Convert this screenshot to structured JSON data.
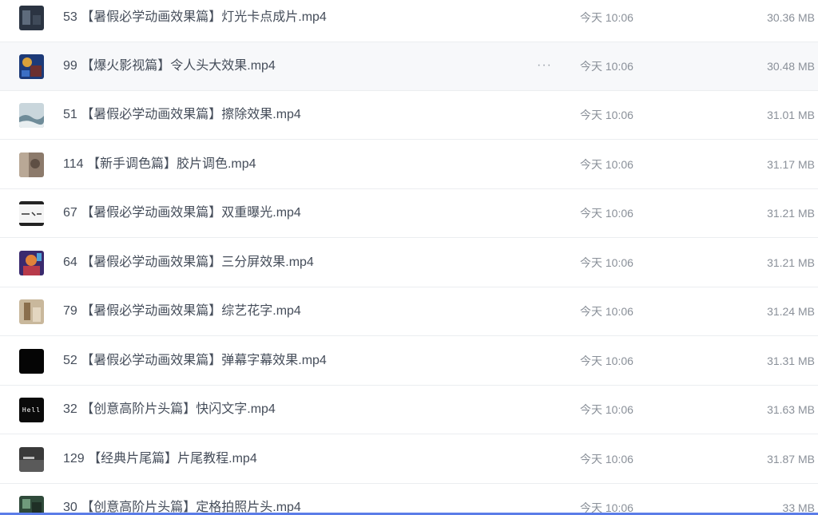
{
  "file_list": {
    "hover_more_icon": "more-horizontal-icon",
    "more_glyph": "···",
    "rows": [
      {
        "name": "53 【暑假必学动画效果篇】灯光卡点成片.mp4",
        "time": "今天 10:06",
        "size": "30.36 MB",
        "thumb": "dark-scene-thumbnail"
      },
      {
        "name": "99 【爆火影视篇】令人头大效果.mp4",
        "time": "今天 10:06",
        "size": "30.48 MB",
        "thumb": "movie-scene-thumbnail"
      },
      {
        "name": "51 【暑假必学动画效果篇】擦除效果.mp4",
        "time": "今天 10:06",
        "size": "31.01 MB",
        "thumb": "sea-scene-thumbnail"
      },
      {
        "name": "114 【新手调色篇】胶片调色.mp4",
        "time": "今天 10:06",
        "size": "31.17 MB",
        "thumb": "film-scene-thumbnail"
      },
      {
        "name": "67 【暑假必学动画效果篇】双重曝光.mp4",
        "time": "今天 10:06",
        "size": "31.21 MB",
        "thumb": "sketch-thumbnail"
      },
      {
        "name": "64 【暑假必学动画效果篇】三分屏效果.mp4",
        "time": "今天 10:06",
        "size": "31.21 MB",
        "thumb": "colorful-character-thumbnail"
      },
      {
        "name": "79 【暑假必学动画效果篇】综艺花字.mp4",
        "time": "今天 10:06",
        "size": "31.24 MB",
        "thumb": "warm-room-thumbnail"
      },
      {
        "name": "52 【暑假必学动画效果篇】弹幕字幕效果.mp4",
        "time": "今天 10:06",
        "size": "31.31 MB",
        "thumb": "black-thumbnail"
      },
      {
        "name": "32 【创意高阶片头篇】快闪文字.mp4",
        "time": "今天 10:06",
        "size": "31.63 MB",
        "thumb": "text-hell-thumbnail",
        "thumb_text": "Hell"
      },
      {
        "name": "129 【经典片尾篇】片尾教程.mp4",
        "time": "今天 10:06",
        "size": "31.87 MB",
        "thumb": "gray-scene-thumbnail"
      },
      {
        "name": "30 【创意高阶片头篇】定格拍照片头.mp4",
        "time": "今天 10:06",
        "size": "33 MB",
        "thumb": "green-scene-thumbnail"
      }
    ]
  }
}
